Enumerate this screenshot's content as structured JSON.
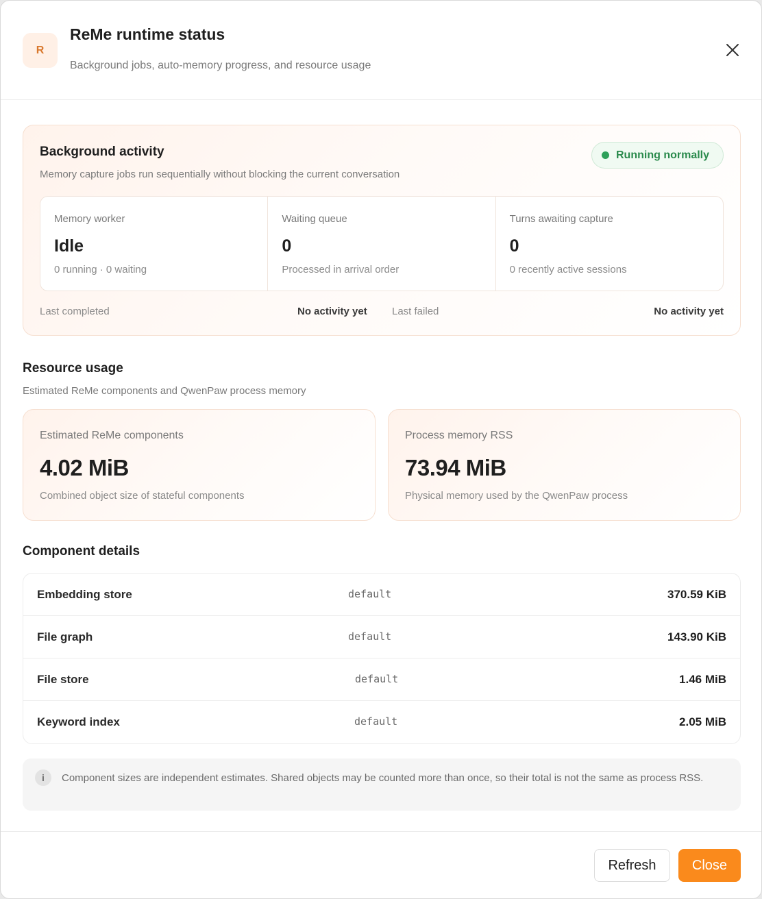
{
  "header": {
    "logo_letter": "R",
    "title": "ReMe runtime status",
    "subtitle": "Background jobs, auto-memory progress, and resource usage",
    "close_icon": "close-icon"
  },
  "activity": {
    "title": "Background activity",
    "subtitle": "Memory capture jobs run sequentially without blocking the current conversation",
    "status": "Running normally",
    "status_color": "#2ea05a",
    "stats": [
      {
        "label": "Memory worker",
        "value": "Idle",
        "note": "0 running · 0 waiting"
      },
      {
        "label": "Waiting queue",
        "value": "0",
        "note": "Processed in arrival order"
      },
      {
        "label": "Turns awaiting capture",
        "value": "0",
        "note": "0 recently active sessions"
      }
    ],
    "last_completed_label": "Last completed",
    "last_completed_value": "No activity yet",
    "last_failed_label": "Last failed",
    "last_failed_value": "No activity yet"
  },
  "resources": {
    "title": "Resource usage",
    "subtitle": "Estimated ReMe components and QwenPaw process memory",
    "cards": [
      {
        "label": "Estimated ReMe components",
        "value": "4.02 MiB",
        "note": "Combined object size of stateful components"
      },
      {
        "label": "Process memory RSS",
        "value": "73.94 MiB",
        "note": "Physical memory used by the QwenPaw process"
      }
    ]
  },
  "components": {
    "title": "Component details",
    "rows": [
      {
        "name": "Embedding store",
        "scope": "default",
        "size": "370.59 KiB"
      },
      {
        "name": "File graph",
        "scope": "default",
        "size": "143.90 KiB"
      },
      {
        "name": "File store",
        "scope": "default",
        "size": "1.46 MiB"
      },
      {
        "name": "Keyword index",
        "scope": "default",
        "size": "2.05 MiB"
      }
    ]
  },
  "note": {
    "icon": "i",
    "text": "Component sizes are independent estimates. Shared objects may be counted more than once, so their total is not the same as process RSS."
  },
  "footer": {
    "refresh_label": "Refresh",
    "close_label": "Close",
    "accent": "#fa8a1c"
  }
}
